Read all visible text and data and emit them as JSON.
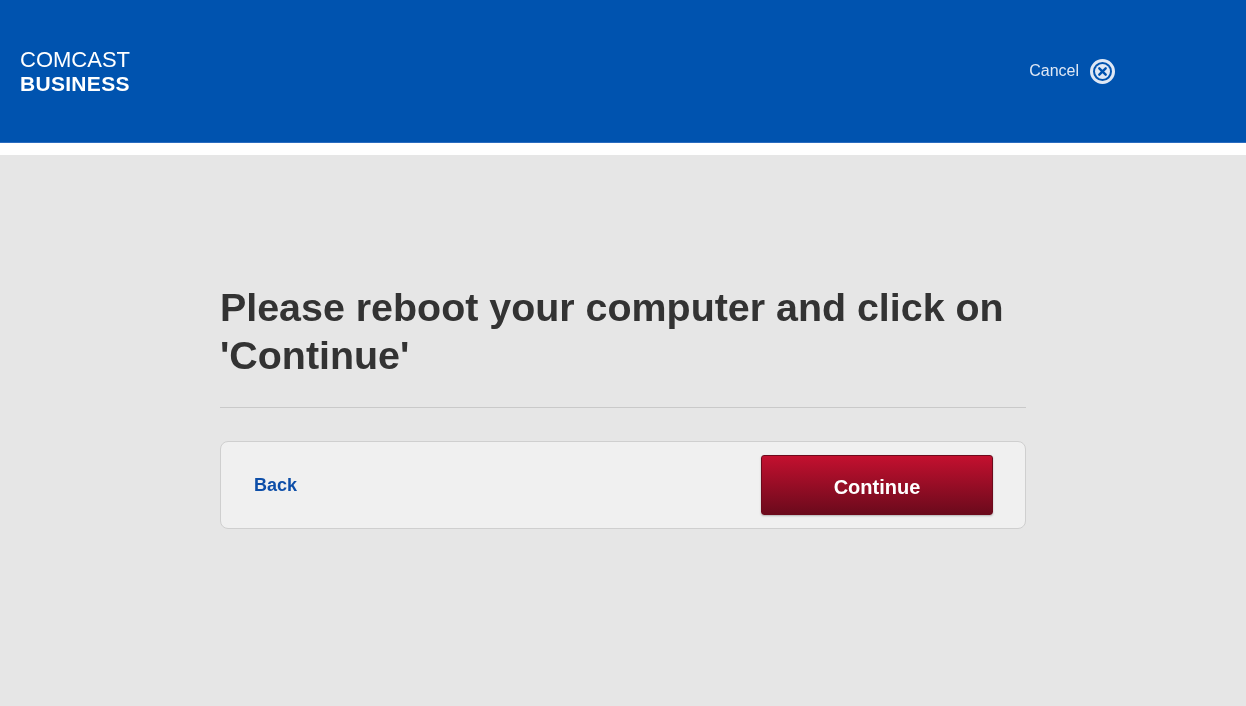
{
  "header": {
    "logo": {
      "line_1": "COMCAST",
      "line_2": "BUSINESS"
    },
    "cancel": {
      "label": "Cancel"
    }
  },
  "main": {
    "heading": "Please reboot your computer and click on 'Continue'",
    "actions": {
      "back": "Back",
      "continue": "Continue"
    }
  }
}
